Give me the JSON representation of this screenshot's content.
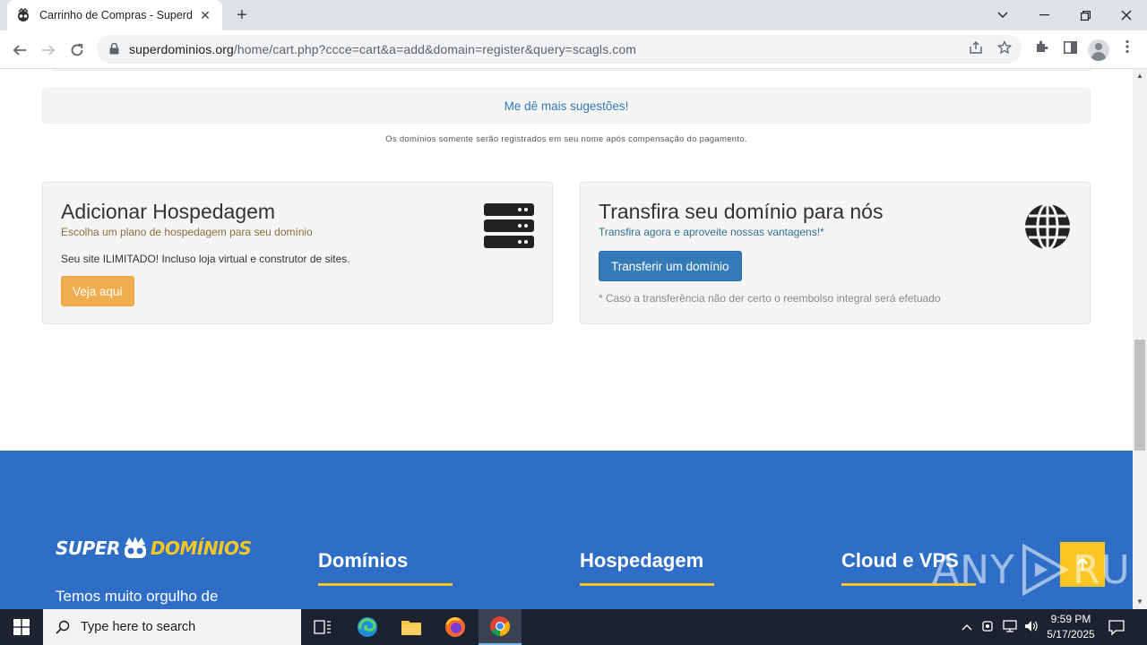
{
  "browser": {
    "tab_title": "Carrinho de Compras - Superdomínios",
    "url_host": "superdominios.org",
    "url_path": "/home/cart.php?ccce=cart&a=add&domain=register&query=scagls.com"
  },
  "page": {
    "suggest_link": "Me dê mais sugestões!",
    "note": "Os domínios somente serão registrados em seu nome após compensação do pagamento.",
    "hosting": {
      "title": "Adicionar Hospedagem",
      "subtitle": "Escolha um plano de hospedagem para seu domínio",
      "subtitle_color": "#8a6d3b",
      "text": "Seu site ILIMITADO! Incluso loja virtual e construtor de sites.",
      "button": "Veja aqui",
      "icon": "server-icon"
    },
    "transfer": {
      "title": "Transfira seu domínio para nós",
      "subtitle": "Transfira agora e aproveite nossas vantagens!*",
      "subtitle_color": "#31708f",
      "button": "Transferir um domínio",
      "footnote": "* Caso a transferência não der certo o reembolso integral será efetuado",
      "icon": "globe-icon"
    }
  },
  "footer": {
    "logo_super": "SUPER",
    "logo_dominios": "DOMÍNIOS",
    "tagline": "Temos muito orgulho de",
    "columns": [
      "Domínios",
      "Hospedagem",
      "Cloud e VPS"
    ],
    "accent": "#f9c623",
    "background": "#2e6ec6",
    "back_to_top_icon": "arrow-up-icon",
    "watermark_left": "ANY",
    "watermark_right": "RUN"
  },
  "taskbar": {
    "search_placeholder": "Type here to search",
    "time": "9:59 PM",
    "date": "5/17/2025"
  }
}
